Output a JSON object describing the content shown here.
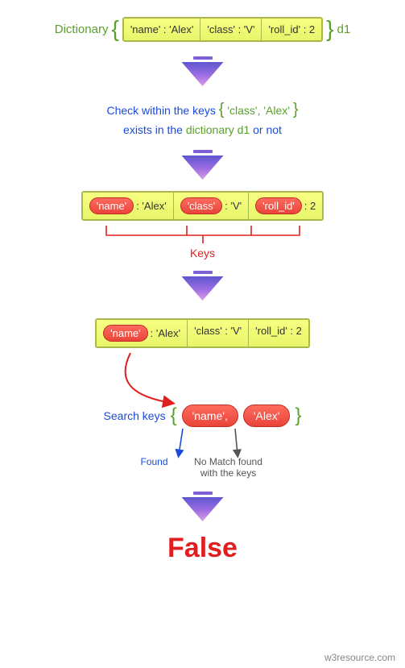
{
  "dict_label": "Dictionary",
  "dict_name": "d1",
  "dict_cells": {
    "c0": "'name' : 'Alex'",
    "c1": "'class' : 'V'",
    "c2": "'roll_id' : 2"
  },
  "check": {
    "line1_a": "Check within the keys",
    "line1_b": "'class', 'Alex'",
    "line2_a": "exists in the",
    "line2_b": "dictionary d1",
    "line2_c": "or not"
  },
  "row_hl": {
    "k0": "'name'",
    "v0": ": 'Alex'",
    "k1": "'class'",
    "v1": ": 'V'",
    "k2": "'roll_id'",
    "v2": ": 2"
  },
  "keys_label": "Keys",
  "row_single": {
    "k0": "'name'",
    "v0": ": 'Alex'",
    "c1": "'class' : 'V'",
    "c2": "'roll_id' : 2"
  },
  "search": {
    "label": "Search keys",
    "p0": "'name',",
    "p1": "'Alex'"
  },
  "results": {
    "found": "Found",
    "nomatch": "No Match found with the keys"
  },
  "final": "False",
  "footer": "w3resource.com",
  "colors": {
    "green": "#5aa02c",
    "blue": "#1a4adc",
    "red": "#e02020"
  }
}
